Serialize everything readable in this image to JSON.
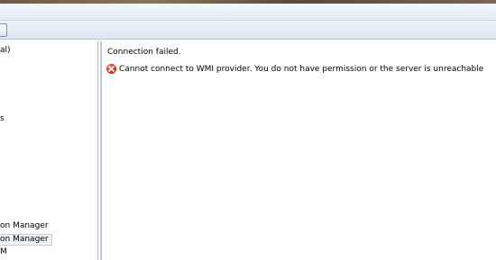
{
  "tree": {
    "items": [
      {
        "label": "al)"
      },
      {
        "label": "s"
      },
      {
        "label": "on Manager"
      },
      {
        "label": "on Manager",
        "selected": true
      },
      {
        "label": "M"
      }
    ]
  },
  "content": {
    "status_title": "Connection failed.",
    "error": {
      "icon": "error-icon",
      "message": "Cannot connect to WMI provider. You do not have permission or the server is unreachable"
    }
  },
  "colors": {
    "error": "#c9261b",
    "toolbar_bg": "#dde7f3",
    "selection_bg": "#eef1f5"
  }
}
